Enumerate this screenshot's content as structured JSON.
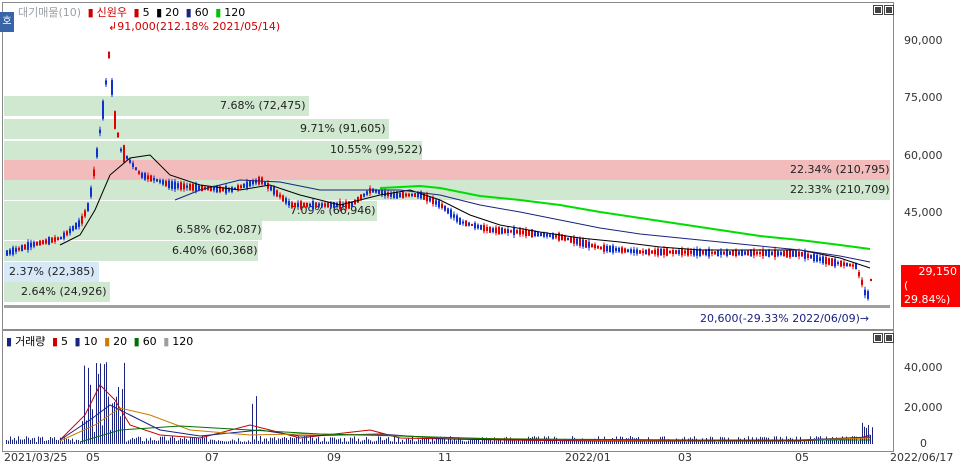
{
  "legend_top": {
    "items": [
      {
        "label": "대기매물(10)",
        "color": "#9aa0a6"
      },
      {
        "label": "신원우",
        "color": "#cc0000"
      },
      {
        "label": "5",
        "color": "#cc0000"
      },
      {
        "label": "20",
        "color": "#000000"
      },
      {
        "label": "60",
        "color": "#1a237e"
      },
      {
        "label": "120",
        "color": "#00c000"
      }
    ],
    "tab_label": "호"
  },
  "legend_bottom": {
    "items": [
      {
        "label": "거래량",
        "color": "#1a237e"
      },
      {
        "label": "5",
        "color": "#cc0000"
      },
      {
        "label": "10",
        "color": "#1a237e"
      },
      {
        "label": "20",
        "color": "#cc7a00"
      },
      {
        "label": "60",
        "color": "#007000"
      },
      {
        "label": "120",
        "color": "#9e9e9e"
      }
    ]
  },
  "price_axis": [
    "90,000",
    "75,000",
    "60,000",
    "45,000"
  ],
  "volume_axis": [
    "40,000",
    "20,000",
    "0"
  ],
  "date_axis": [
    "2021/03/25",
    "05",
    "07",
    "09",
    "11",
    "2022/01",
    "03",
    "05",
    "2022/06/17"
  ],
  "annotations": {
    "high": "91,000(212.18% 2021/05/14)",
    "low": "20,600(-29.33% 2022/06/09)"
  },
  "current_price": {
    "price": "29,150",
    "change": "( 29.84%)"
  },
  "bands": [
    {
      "label": "7.68% (72,475)",
      "color": "#cfe8cf"
    },
    {
      "label": "9.71% (91,605)",
      "color": "#cfe8cf"
    },
    {
      "label": "10.55% (99,522)",
      "color": "#cfe8cf"
    },
    {
      "label": "22.34% (210,795)",
      "color": "#f2bcbc"
    },
    {
      "label": "22.33% (210,709)",
      "color": "#cfe8cf"
    },
    {
      "label": "7.09% (66,946)",
      "color": "#cfe8cf"
    },
    {
      "label": "6.58% (62,087)",
      "color": "#cfe8cf"
    },
    {
      "label": "6.40% (60,368)",
      "color": "#cfe8cf"
    },
    {
      "label": "2.37% (22,385)",
      "color": "#cfe8cf"
    },
    {
      "label": "2.64% (24,926)",
      "color": "#cfe8cf"
    }
  ],
  "colors": {
    "up": "#e00000",
    "down": "#1030d0",
    "ma5": "#cc0000",
    "ma20": "#000000",
    "ma60": "#1a237e",
    "ma120": "#00dd00",
    "volume": "#1a237e"
  }
}
